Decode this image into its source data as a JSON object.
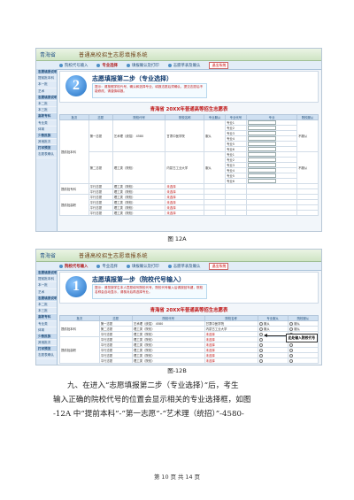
{
  "screenshot1": {
    "app": "青海省",
    "system": "普通高校招生志愿填报系统",
    "tabs": [
      "院校代号输入",
      "专业选择",
      "填报确认及打印",
      "志愿草表及确认"
    ],
    "nav_button": "退出系统",
    "sidebar": [
      "志愿填报说明",
      "提前批本科",
      "本一批",
      "艺术",
      "志愿填报说明",
      "本二批",
      "本三批",
      "高职专科",
      "专业类",
      "体育",
      "少数民族",
      "其他批次",
      "打印预览",
      "志愿表确认"
    ],
    "step_title": "志愿填报第二步（专业选择）",
    "step_tip": "提示：请按照学校代号，确认和选择专业，填报志愿后须确认，提交志愿后不能修改，请谨慎填报。",
    "form_title": "青海省 20XX年普通高等招生志愿表",
    "headers": [
      "批次",
      "志愿",
      "院校代号",
      "院校名称",
      "专业服从",
      "专业代号",
      "专业",
      "院校服从"
    ],
    "batch1": "提前批本科",
    "batch2": "提前批专科",
    "batch3": "提前批高职",
    "vol1": "第一志愿",
    "vol2": "第二志愿",
    "school1_cat": "艺术理（统招）",
    "school1_code": "4580",
    "school1_name": "甘肃中医学院",
    "school2_cat": "理工类（院校）",
    "school2_name": "内蒙古工业大学",
    "parallel": "平行志愿",
    "obey": "服从",
    "major_labels": [
      "专业1",
      "专业2",
      "专业3",
      "专业4",
      "专业5",
      "专业6"
    ],
    "unfilled": "未选择",
    "undecided": "不服从"
  },
  "caption1": "图 12A",
  "screenshot2": {
    "app": "青海省",
    "system": "普通高校招生志愿填报系统",
    "tabs": [
      "院校代号输入",
      "专业选择",
      "填报确认及打印",
      "志愿草表及确认"
    ],
    "nav_button": "退出系统",
    "step_title": "志愿填报第一步（院校代号输入）",
    "step_tip": "提示：请您按学生本人意愿填写院校代号，院校代号输入后请按回车键，院校名称会自动显示，请核对后再选择专业。",
    "form_title": "青海省 20XX年普通高等招生志愿表",
    "callout": "此处输入院校代号",
    "school_name": "甘肃中医学院"
  },
  "caption2": "图-12B",
  "paragraph": {
    "line1": "九、在进入“志愿填报第二步（专业选择）”后，考生",
    "line2": "输入正确的院校代号的位置会显示相关的专业选择框，如图",
    "line3": "-12A 中“提前本科”-“第一志愿”-“艺术理（统招）”-4580-"
  },
  "footer": "第 10 页 共 14 页"
}
